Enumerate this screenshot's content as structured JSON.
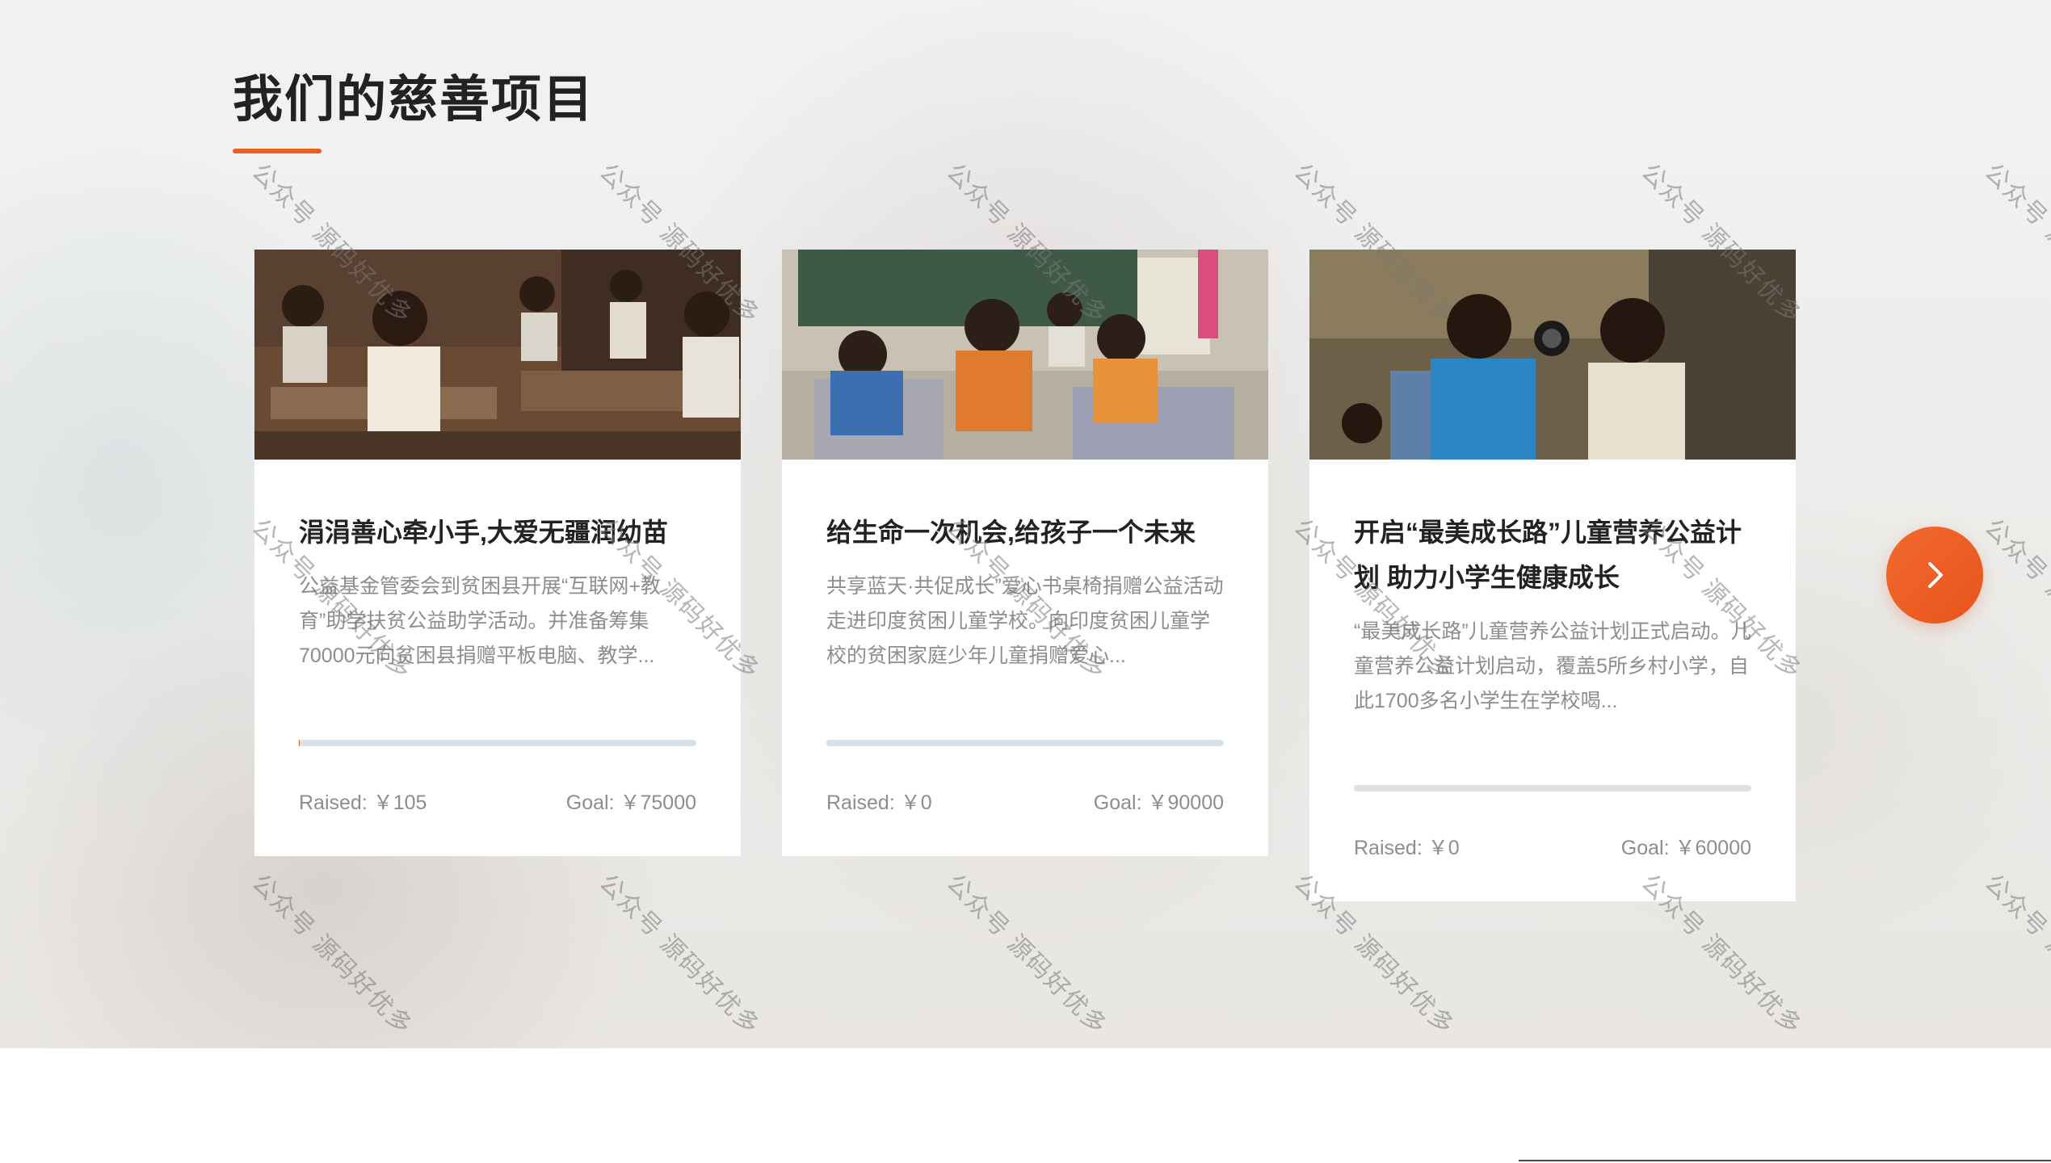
{
  "section": {
    "title": "我们的慈善项目"
  },
  "projects": [
    {
      "title": "涓涓善心牵小手,大爱无疆润幼苗",
      "description": "公益基金管委会到贫困县开展“互联网+教育”助学扶贫公益助学活动。并准备筹集70000元向贫困县捐赠平板电脑、教学...",
      "raised_label": "Raised: ￥105",
      "goal_label": "Goal: ￥75000",
      "progress": 0.0014
    },
    {
      "title": "给生命一次机会,给孩子一个未来",
      "description": "共享蓝天·共促成长”爱心书桌椅捐赠公益活动走进印度贫困儿童学校。向印度贫困儿童学校的贫困家庭少年儿童捐赠爱心...",
      "raised_label": "Raised: ￥0",
      "goal_label": "Goal: ￥90000",
      "progress": 0
    },
    {
      "title": "开启“最美成长路”儿童营养公益计划 助力小学生健康成长",
      "description": "“最美成长路”儿童营养公益计划正式启动。儿童营养公益计划启动，覆盖5所乡村小学，自此1700多名小学生在学校喝...",
      "raised_label": "Raised: ￥0",
      "goal_label": "Goal: ￥60000",
      "progress": 0
    }
  ],
  "carousel": {
    "next_icon": "chevron-right-icon"
  },
  "watermark": {
    "text": "公众号 源码好优多"
  },
  "colors": {
    "accent": "#e8611f",
    "title": "#222222",
    "muted": "#8d8d8d",
    "track": "#d9e0e6"
  }
}
